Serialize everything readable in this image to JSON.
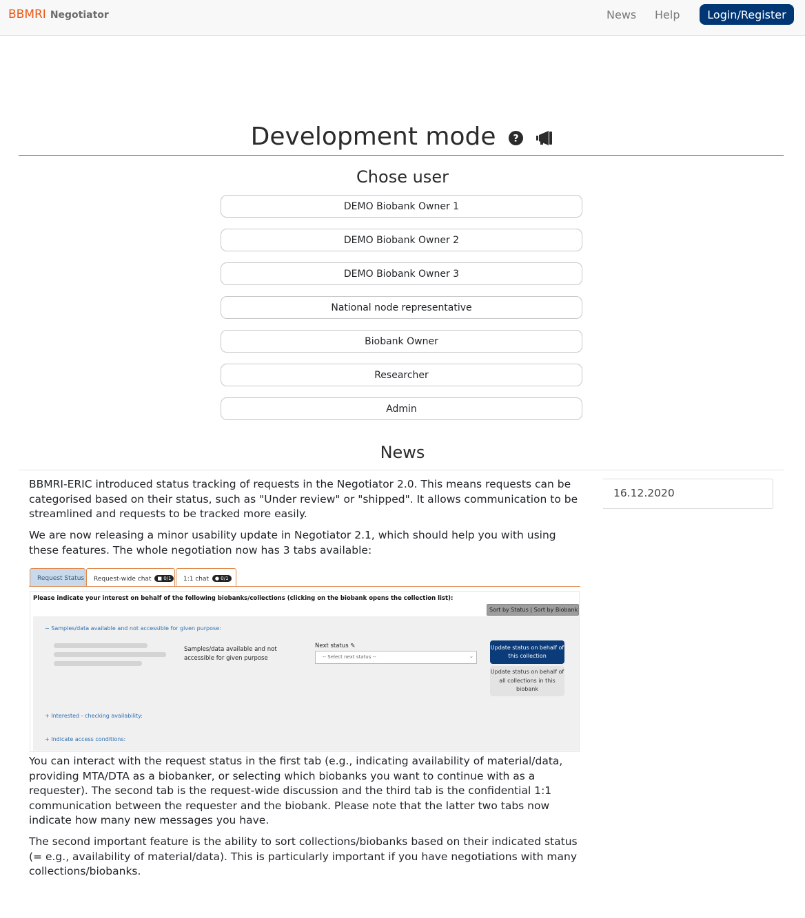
{
  "navbar": {
    "brand_primary": "BBMRI",
    "brand_secondary": "Negotiator",
    "links": [
      "News",
      "Help"
    ],
    "login_label": "Login/Register"
  },
  "dev": {
    "title": "Development mode",
    "icons": [
      "question-circle-icon",
      "megaphone-icon"
    ],
    "chose_user": "Chose user",
    "users": [
      "DEMO Biobank Owner 1",
      "DEMO Biobank Owner 2",
      "DEMO Biobank Owner 3",
      "National node representative",
      "Biobank Owner",
      "Researcher",
      "Admin"
    ]
  },
  "news": {
    "heading": "News",
    "date": "16.12.2020",
    "paragraphs": [
      "BBMRI-ERIC introduced status tracking of requests in the Negotiator 2.0. This means requests can be categorised based on their status, such as \"Under review\" or \"shipped\". It allows communication to be streamlined and requests to be tracked more easily.",
      "We are now releasing a minor usability update in Negotiator 2.1, which should help you with using these features. The whole negotiation now has 3 tabs available:",
      "You can interact with the request status in the first tab (e.g., indicating availability of material/data, providing MTA/DTA as a biobanker, or selecting which biobanks you want to continue with as a requester). The second tab is the request-wide discussion and the third tab is the confidential 1:1 communication between the requester and the biobank. Please note that the latter two tabs now indicate how many new messages you have.",
      "The second important feature is the ability to sort collections/biobanks based on their indicated status (= e.g., availability of material/data). This is particularly important if you have negotiations with many collections/biobanks."
    ]
  },
  "screenshot": {
    "tabs": [
      {
        "label": "Request Status"
      },
      {
        "label": "Request-wide chat",
        "badge": "0/1"
      },
      {
        "label": "1:1 chat",
        "badge": "0/1"
      }
    ],
    "heading": "Please indicate your interest on behalf of the following biobanks/collections (clicking on the biobank opens the collection list):",
    "sort_label": "Sort by Status | Sort by Biobank",
    "section1": "Samples/data available and not accessible for given purpose:",
    "description": "Samples/data available and not accessible for given purpose",
    "next_status_label": "Next status",
    "select_placeholder": "-- Select next status --",
    "update_collection_label": "Update status on behalf of this collection",
    "update_all_label": "Update status on behalf of all collections in this biobank",
    "section2": "Interested - checking availability:",
    "section3": "Indicate access conditions:"
  }
}
